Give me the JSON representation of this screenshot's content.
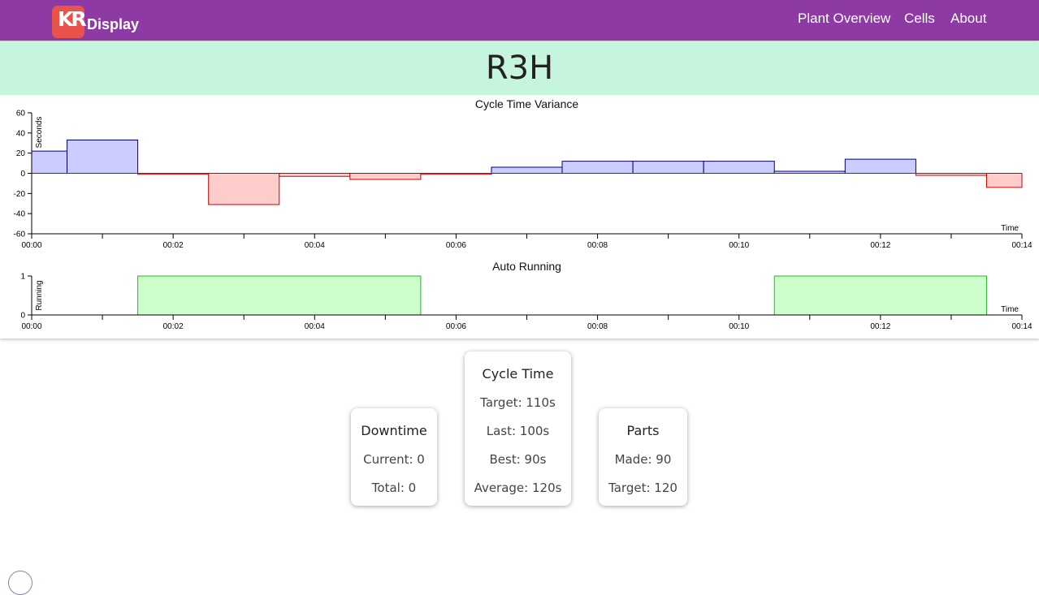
{
  "nav": {
    "logo_letters": "KR",
    "brand": "Display",
    "links": [
      "Plant Overview",
      "Cells",
      "About"
    ]
  },
  "page_title": "R3H",
  "chart_data": [
    {
      "type": "area",
      "title": "Cycle Time Variance",
      "ylabel": "Seconds",
      "xlabel": "Time",
      "ylim": [
        -60,
        60
      ],
      "yticks": [
        60,
        40,
        20,
        0,
        -20,
        -40,
        -60
      ],
      "xlim": [
        "00:00",
        "00:14"
      ],
      "xticks": [
        "00:00",
        "00:02",
        "00:04",
        "00:06",
        "00:08",
        "00:10",
        "00:12",
        "00:14"
      ],
      "step": "after",
      "x": [
        0,
        0.5,
        1.5,
        2.5,
        3.5,
        4.5,
        5.5,
        6.5,
        7.5,
        8.5,
        9.5,
        10.5,
        11.5,
        12.5,
        13.5,
        14
      ],
      "values": [
        22,
        33,
        -1,
        -31,
        -3,
        -6,
        -1,
        6,
        12,
        12,
        12,
        2,
        14,
        -2,
        -14,
        -14
      ],
      "colors": {
        "positive_fill": "#ccccff",
        "positive_line": "#00008b",
        "negative_fill": "#ffcccc",
        "negative_line": "#cc0000"
      }
    },
    {
      "type": "area",
      "title": "Auto Running",
      "ylabel": "Running",
      "xlabel": "Time",
      "ylim": [
        0,
        1
      ],
      "yticks": [
        1,
        0
      ],
      "xlim": [
        "00:00",
        "00:14"
      ],
      "xticks": [
        "00:00",
        "00:02",
        "00:04",
        "00:06",
        "00:08",
        "00:10",
        "00:12",
        "00:14"
      ],
      "step": "after",
      "x": [
        0,
        1.5,
        5.5,
        10.5,
        13.5,
        14
      ],
      "values": [
        0,
        1,
        0,
        1,
        0,
        0
      ],
      "colors": {
        "fill": "#ccffcc",
        "line": "#22bb22"
      }
    }
  ],
  "cards": {
    "downtime": {
      "title": "Downtime",
      "lines": [
        "Current: 0",
        "Total: 0"
      ]
    },
    "cycle_time": {
      "title": "Cycle Time",
      "lines": [
        "Target: 110s",
        "Last: 100s",
        "Best: 90s",
        "Average: 120s"
      ]
    },
    "parts": {
      "title": "Parts",
      "lines": [
        "Made: 90",
        "Target: 120"
      ]
    }
  }
}
